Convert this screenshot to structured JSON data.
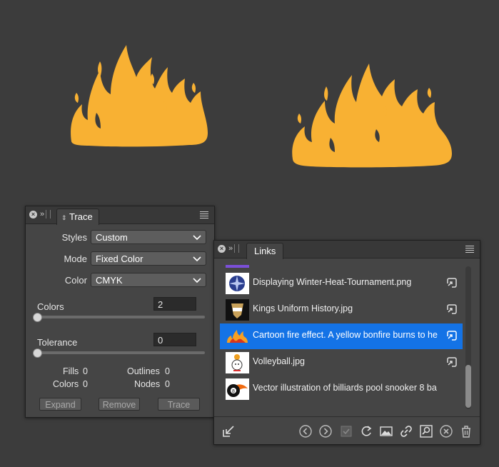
{
  "canvas": {
    "background": "#3c3c3c",
    "flame_color": "#f8b133"
  },
  "trace_panel": {
    "tab_label": "Trace",
    "styles_label": "Styles",
    "styles_value": "Custom",
    "mode_label": "Mode",
    "mode_value": "Fixed Color",
    "color_label": "Color",
    "color_value": "CMYK",
    "colors_label": "Colors",
    "colors_value": "2",
    "tolerance_label": "Tolerance",
    "tolerance_value": "0",
    "fills_label": "Fills",
    "fills_value": "0",
    "outlines_label": "Outlines",
    "outlines_value": "0",
    "colors_stat_label": "Colors",
    "colors_stat_value": "0",
    "nodes_label": "Nodes",
    "nodes_value": "0",
    "expand_label": "Expand",
    "remove_label": "Remove",
    "trace_label": "Trace"
  },
  "links_panel": {
    "tab_label": "Links",
    "items": [
      {
        "name": "Displaying Winter-Heat-Tournament.png",
        "thumb": "winter-tournament-thumb"
      },
      {
        "name": "Kings Uniform History.jpg",
        "thumb": "kings-uniform-thumb"
      },
      {
        "name": "Cartoon fire effect. A yellow bonfire burns to he",
        "thumb": "fire-thumb",
        "selected": true
      },
      {
        "name": "Volleyball.jpg",
        "thumb": "volleyball-thumb"
      },
      {
        "name": "Vector illustration of billiards pool snooker 8 ba",
        "thumb": "billiard-thumb"
      }
    ]
  }
}
